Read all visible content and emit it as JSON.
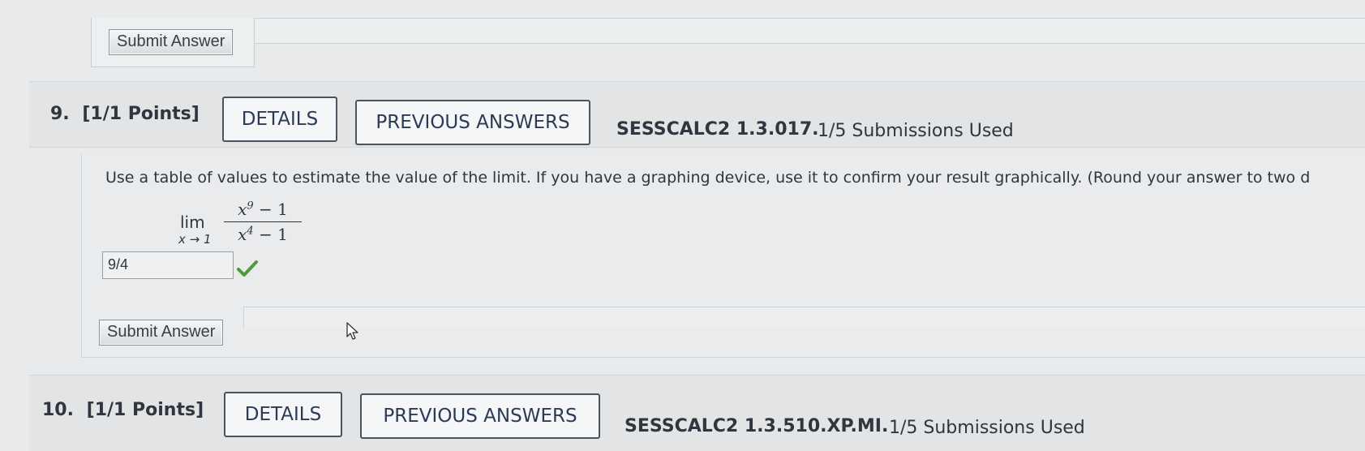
{
  "top_panel": {
    "submit_label": "Submit Answer"
  },
  "question9": {
    "number": "9.",
    "points": "[1/1 Points]",
    "details_label": "DETAILS",
    "previous_answers_label": "PREVIOUS ANSWERS",
    "code": "SESSCALC2 1.3.017.",
    "submissions": "1/5 Submissions Used",
    "instruction": "Use a table of values to estimate the value of the limit. If you have a graphing device, use it to confirm your result graphically. (Round your answer to two d",
    "math": {
      "lim": "lim",
      "lim_sub": "x → 1",
      "num_base": "x",
      "num_exp": "9",
      "num_rest": " − 1",
      "den_base": "x",
      "den_exp": "4",
      "den_rest": " − 1"
    },
    "answer_value": "9/4",
    "submit_label": "Submit Answer",
    "status_color": "#4f9a3a"
  },
  "question10": {
    "number": "10.",
    "points": "[1/1 Points]",
    "details_label": "DETAILS",
    "previous_answers_label": "PREVIOUS ANSWERS",
    "code": "SESSCALC2 1.3.510.XP.MI.",
    "submissions": "1/5 Submissions Used"
  },
  "icons": {
    "answer_status": "check-icon",
    "pointer": "mouse-cursor-icon"
  }
}
